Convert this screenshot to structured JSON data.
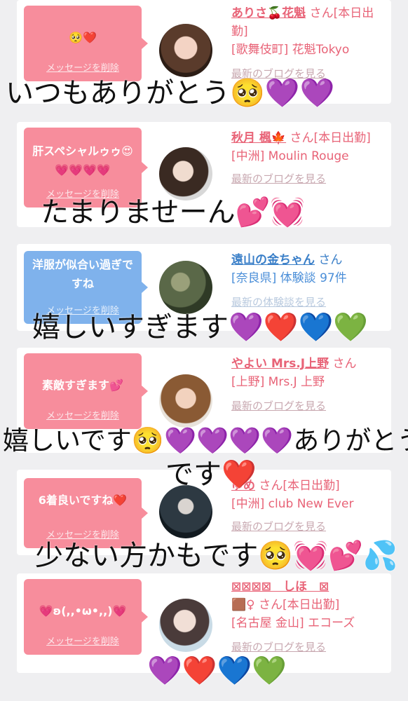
{
  "delete_label": "メッセージを削除",
  "cards": [
    {
      "message": "🥺❤️",
      "name": "ありさ🍒花魁",
      "san": "さん[本日出勤]",
      "area": "[歌舞伎町] 花魁Tokyo",
      "link": "最新のブログを見る"
    },
    {
      "message": "肝スペシャルゥゥ😍💗💗💗💗",
      "name": "秋月 楓🍁",
      "san": "さん[本日出勤]",
      "area": "[中洲] Moulin Rouge",
      "link": "最新のブログを見る"
    },
    {
      "message": "洋服が似合い過ぎですね",
      "name": "遠山の金ちゃん",
      "san": "さん",
      "area": "[奈良県] 体験談 97件",
      "link": "最新の体験談を見る"
    },
    {
      "message": "素敵すぎます💕",
      "name": "やよい Mrs.J上野",
      "san": "さん",
      "area": "[上野] Mrs.J 上野",
      "link": "最新のブログを見る"
    },
    {
      "message": "6着良いですね❤️",
      "name": "ゆめ",
      "san": "さん[本日出勤]",
      "area": "[中洲] club New Ever",
      "link": "最新のブログを見る"
    },
    {
      "message": "💗ʚ(,,•ω•,,)💗",
      "name": "⊠⊠⊠⊠　しほ　⊠",
      "name2": "🟫♀",
      "san": "さん[本日出勤]",
      "area": "[名古屋 金山] エコーズ",
      "link": "最新のブログを見る"
    }
  ],
  "overlays": [
    "いつもありがとう🥺💜💜",
    "たまりませーん💕💓",
    "嬉しいすぎます💜❤️💙💚",
    "嬉しいです🥺💜💜💜💜ありがとう",
    "です❤️",
    "少ない方かもです🥺💓💕💦",
    "💜❤️💙💚"
  ]
}
